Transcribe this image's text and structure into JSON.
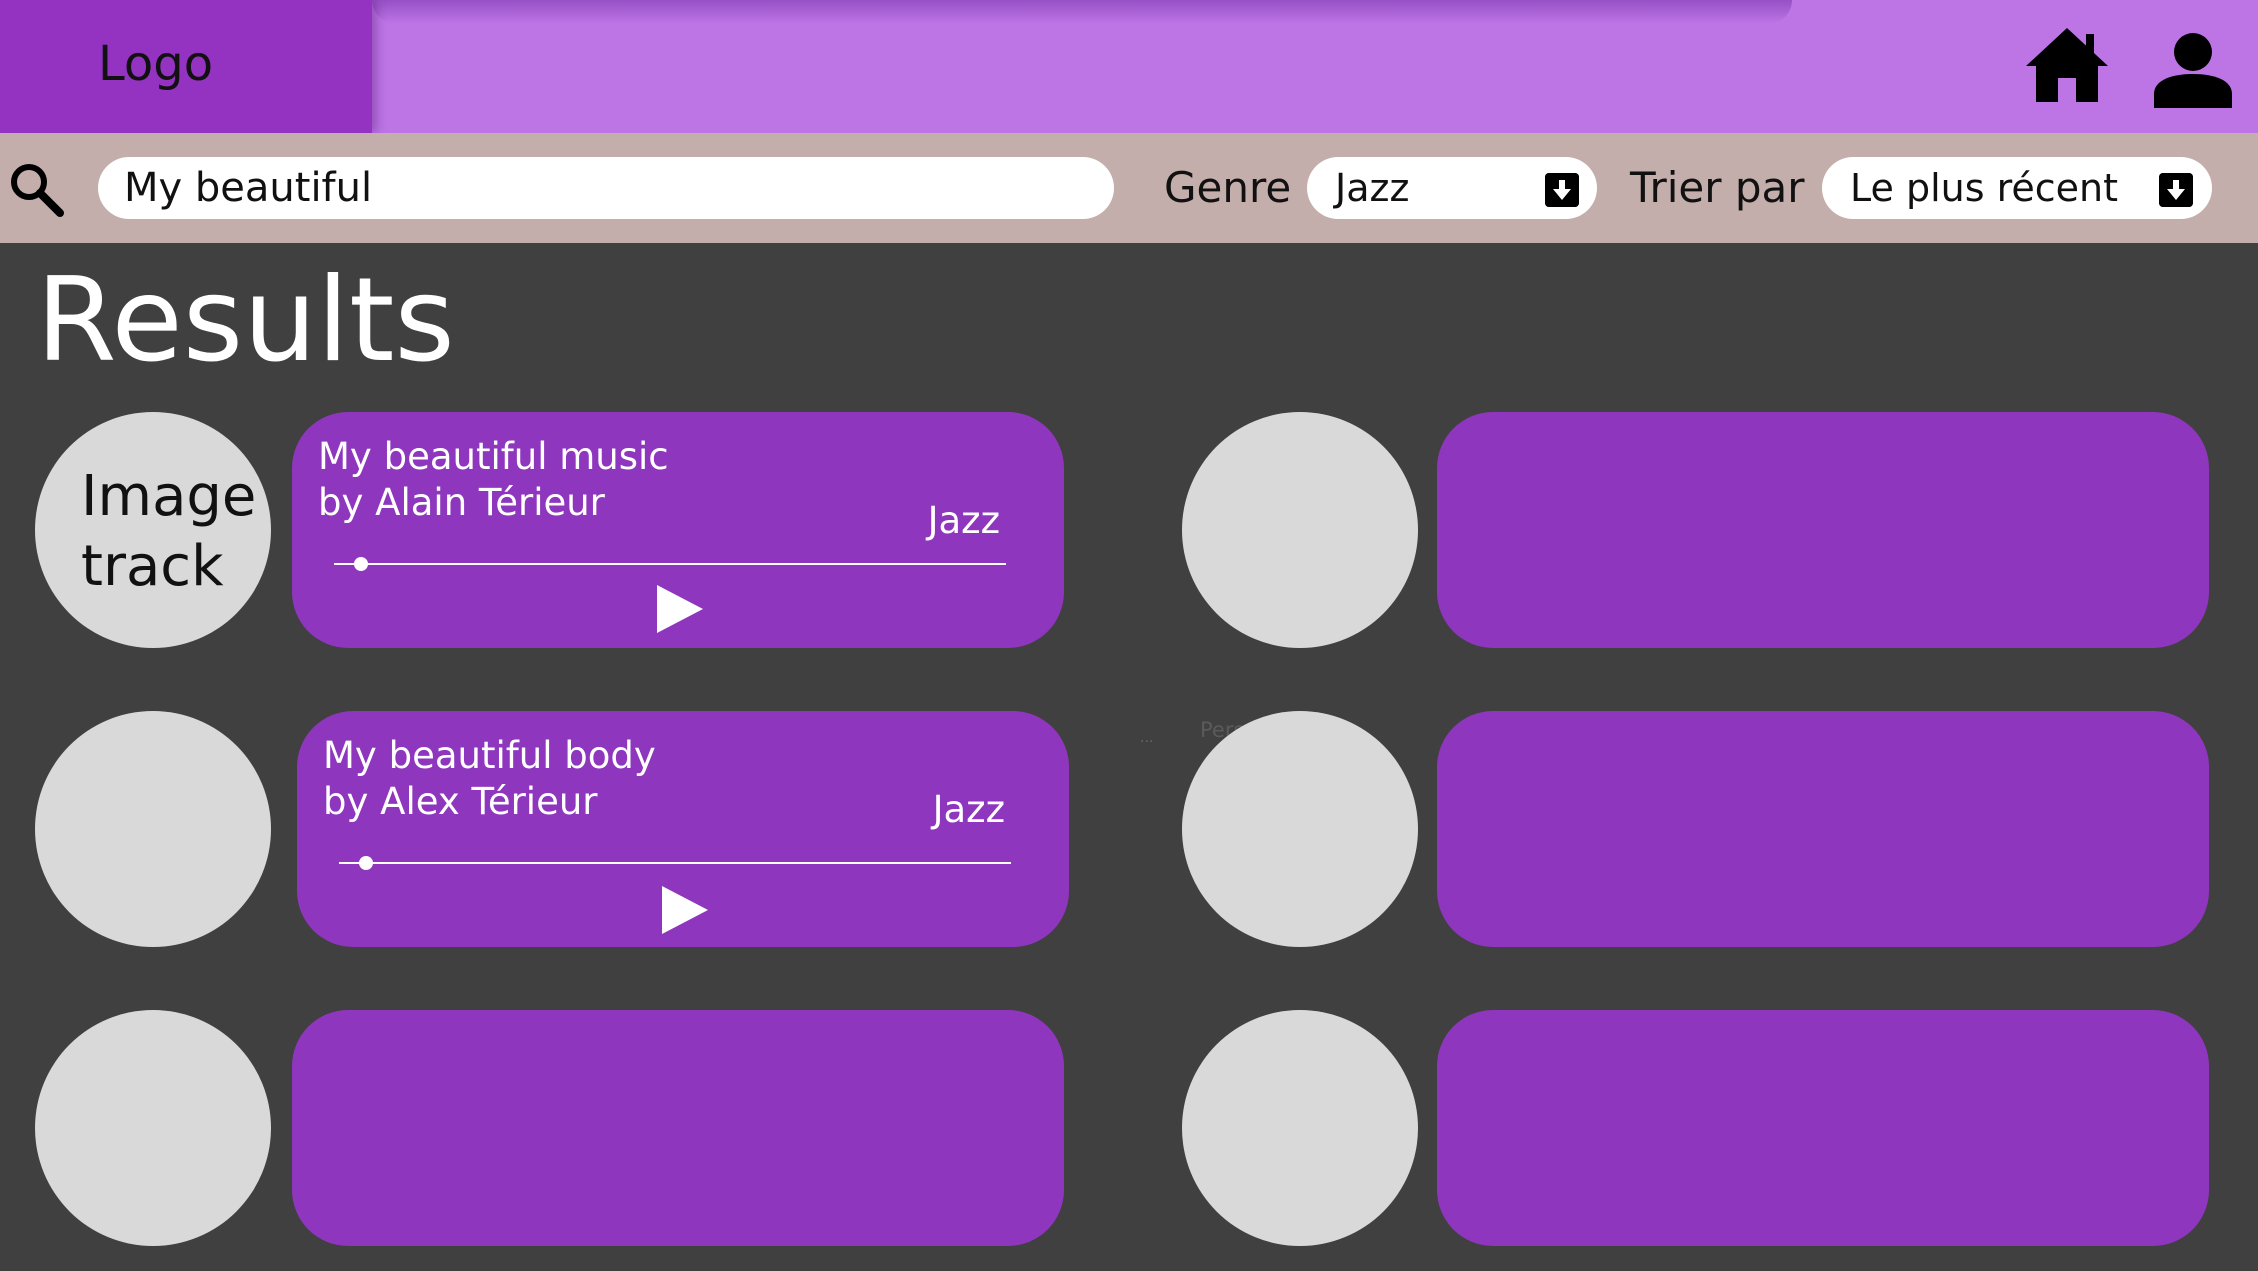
{
  "header": {
    "logo": "Logo",
    "home_icon": "home-icon",
    "user_icon": "user-icon"
  },
  "filters": {
    "search_icon": "search-icon",
    "search_value": "My beautiful",
    "genre_label": "Genre",
    "genre_value": "Jazz",
    "sort_label": "Trier par",
    "sort_value": "Le plus récent"
  },
  "results": {
    "title": "Results",
    "tracks": [
      {
        "image_label": "Image\ntrack",
        "title_line1": "My beautiful music",
        "title_line2": "by Alain Térieur",
        "genre": "Jazz",
        "progress": 0.04
      },
      {
        "image_label": "",
        "title_line1": "My beautiful body",
        "title_line2": "by Alex Térieur",
        "genre": "Jazz",
        "progress": 0.04
      }
    ]
  },
  "ghost": {
    "person_text": "Person",
    "dots": "..."
  },
  "colors": {
    "header": "#bd75e6",
    "logo_box": "#9432c2",
    "filter_bar": "#c4aeab",
    "background": "#404040",
    "card": "#8e36bd",
    "thumb": "#d9d9d9"
  }
}
